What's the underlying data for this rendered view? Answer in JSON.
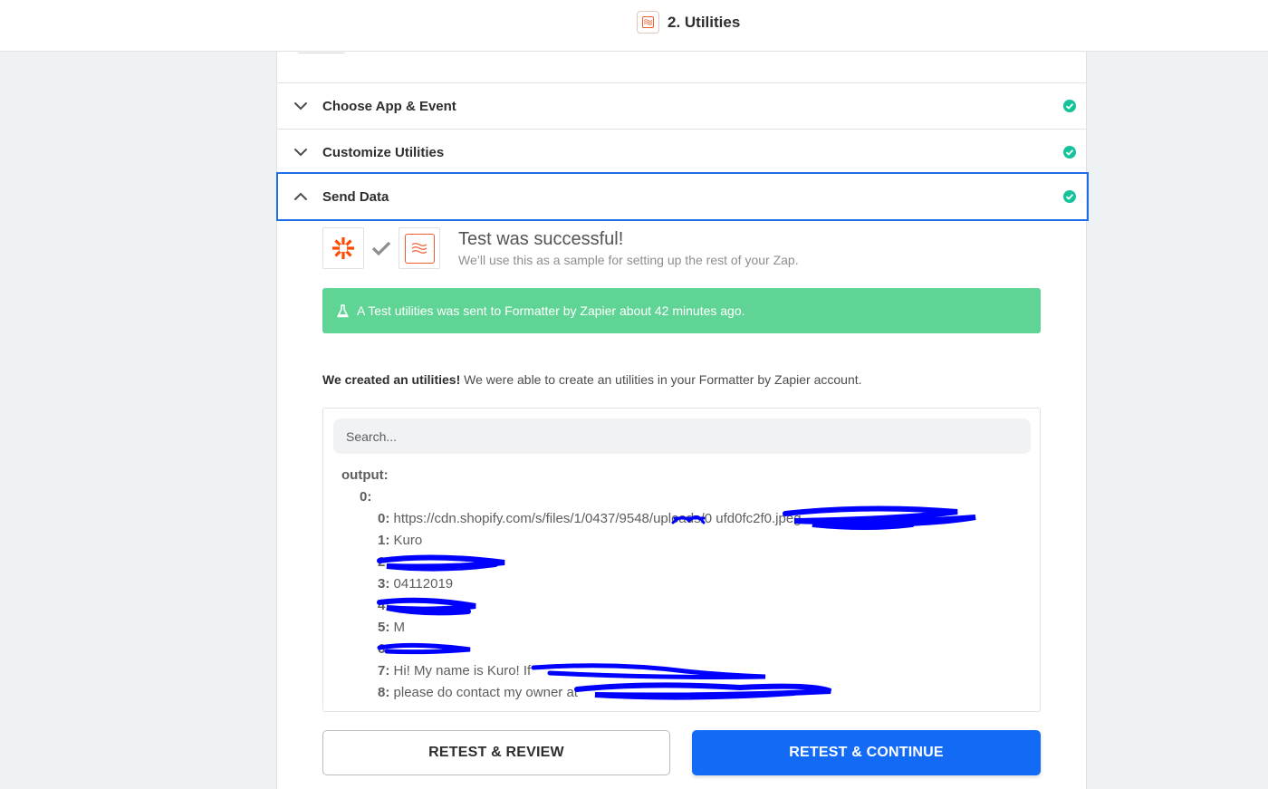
{
  "topbar": {
    "title": "2. Utilities"
  },
  "sections": [
    {
      "label": "Choose App & Event",
      "state": "collapsed",
      "complete": true
    },
    {
      "label": "Customize Utilities",
      "state": "collapsed",
      "complete": true
    },
    {
      "label": "Send Data",
      "state": "expanded",
      "complete": true
    }
  ],
  "test_result": {
    "title": "Test was successful!",
    "subtitle": "We’ll use this as a sample for setting up the rest of your Zap.",
    "banner": "A Test utilities was sent to Formatter by Zapier about 42 minutes ago.",
    "created_bold": "We created an utilities!",
    "created_rest": " We were able to create an utilities in your Formatter by Zapier account."
  },
  "search": {
    "placeholder": "Search..."
  },
  "output": {
    "root_key": "output:",
    "item_key": "0:",
    "rows": [
      {
        "key": "0:",
        "value": "https://cdn.shopify.com/s/files/1/0437/9548/uploads/0 ufd0fc2f0.jpeg"
      },
      {
        "key": "1:",
        "value": "Kuro"
      },
      {
        "key": "2:",
        "value": ""
      },
      {
        "key": "3:",
        "value": "04112019"
      },
      {
        "key": "4:",
        "value": ""
      },
      {
        "key": "5:",
        "value": "M"
      },
      {
        "key": "6:",
        "value": ""
      },
      {
        "key": "7:",
        "value": "Hi! My name is Kuro! If"
      },
      {
        "key": "8:",
        "value": "please do contact my owner at"
      }
    ]
  },
  "buttons": {
    "review": "RETEST & REVIEW",
    "continue": "RETEST & CONTINUE"
  },
  "colors": {
    "accent": "#136bf5",
    "success": "#5fd495",
    "check": "#15c39a",
    "zapier_orange": "#ff4a00",
    "redaction": "#0000ff"
  }
}
